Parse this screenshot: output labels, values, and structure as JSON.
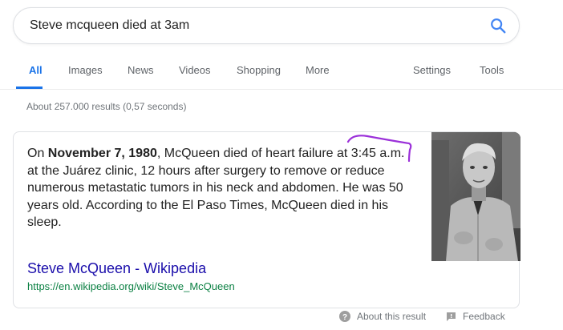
{
  "search": {
    "query": "Steve mcqueen died at 3am"
  },
  "tabs": {
    "all": "All",
    "images": "Images",
    "news": "News",
    "videos": "Videos",
    "shopping": "Shopping",
    "more": "More",
    "settings": "Settings",
    "tools": "Tools"
  },
  "result_stats": "About 257.000 results (0,57 seconds)",
  "snippet": {
    "text_pre": "On ",
    "date_bold": "November 7, 1980",
    "text_post": ", McQueen died of heart failure at 3:45 a.m. at the Juárez clinic, 12 hours after surgery to remove or reduce numerous metastatic tumors in his neck and abdomen. He was 50 years old. According to the El Paso Times, McQueen died in his sleep.",
    "title": "Steve McQueen - Wikipedia",
    "url": "https://en.wikipedia.org/wiki/Steve_McQueen"
  },
  "footer": {
    "about": "About this result",
    "feedback": "Feedback"
  },
  "colors": {
    "accent": "#1a73e8",
    "link": "#1a0dab",
    "url": "#0b8043",
    "annotation": "#9b30d9"
  }
}
